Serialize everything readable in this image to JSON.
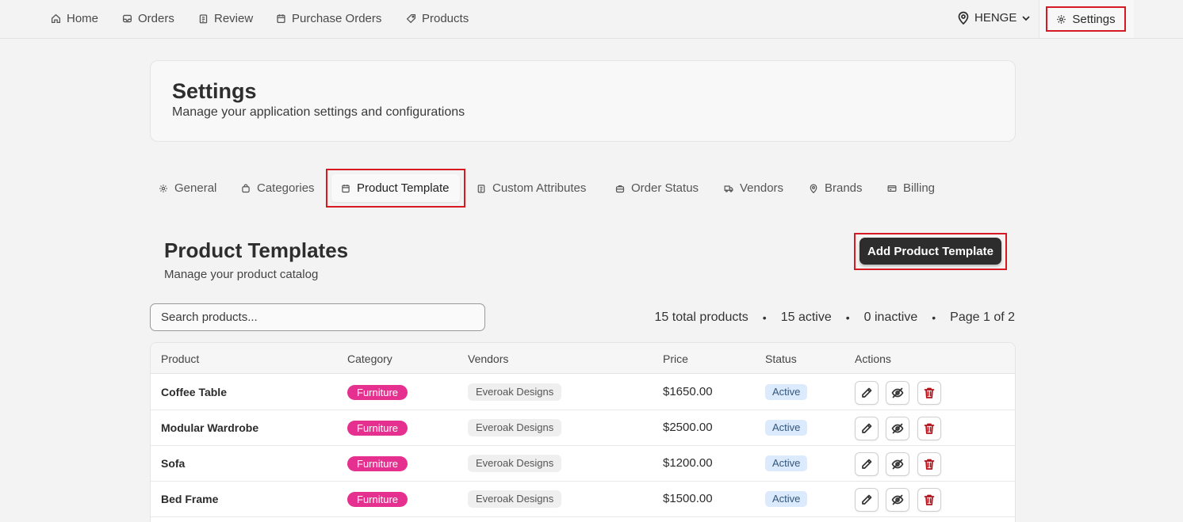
{
  "nav": {
    "items": [
      {
        "label": "Home",
        "icon": "home-icon"
      },
      {
        "label": "Orders",
        "icon": "inbox-icon"
      },
      {
        "label": "Review",
        "icon": "clipboard-icon"
      },
      {
        "label": "Purchase Orders",
        "icon": "calendar-icon"
      },
      {
        "label": "Products",
        "icon": "tag-icon"
      }
    ],
    "location": "HENGE",
    "settings_label": "Settings"
  },
  "header": {
    "title": "Settings",
    "subtitle": "Manage your application settings and configurations"
  },
  "tabs": [
    {
      "label": "General"
    },
    {
      "label": "Categories"
    },
    {
      "label": "Product Template"
    },
    {
      "label": "Custom Attributes"
    },
    {
      "label": "Order Status"
    },
    {
      "label": "Vendors"
    },
    {
      "label": "Brands"
    },
    {
      "label": "Billing"
    }
  ],
  "active_tab": "Product Template",
  "section": {
    "title": "Product Templates",
    "subtitle": "Manage your product catalog",
    "add_button": "Add Product Template"
  },
  "search": {
    "placeholder": "Search products...",
    "value": ""
  },
  "stats": {
    "total": "15 total products",
    "active": "15 active",
    "inactive": "0 inactive",
    "page": "Page 1 of 2",
    "separator": "•"
  },
  "table": {
    "columns": [
      "Product",
      "Category",
      "Vendors",
      "Price",
      "Status",
      "Actions"
    ],
    "rows": [
      {
        "product": "Coffee Table",
        "category": "Furniture",
        "vendor": "Everoak Designs",
        "price": "$1650.00",
        "status": "Active"
      },
      {
        "product": "Modular Wardrobe",
        "category": "Furniture",
        "vendor": "Everoak Designs",
        "price": "$2500.00",
        "status": "Active"
      },
      {
        "product": "Sofa",
        "category": "Furniture",
        "vendor": "Everoak Designs",
        "price": "$1200.00",
        "status": "Active"
      },
      {
        "product": "Bed Frame",
        "category": "Furniture",
        "vendor": "Everoak Designs",
        "price": "$1500.00",
        "status": "Active"
      }
    ]
  },
  "colors": {
    "highlight": "#d71921",
    "category_badge": "#e6308f",
    "status_badge_bg": "#dbeafc",
    "primary_button": "#2d2d2d",
    "delete_icon": "#b3121b"
  }
}
